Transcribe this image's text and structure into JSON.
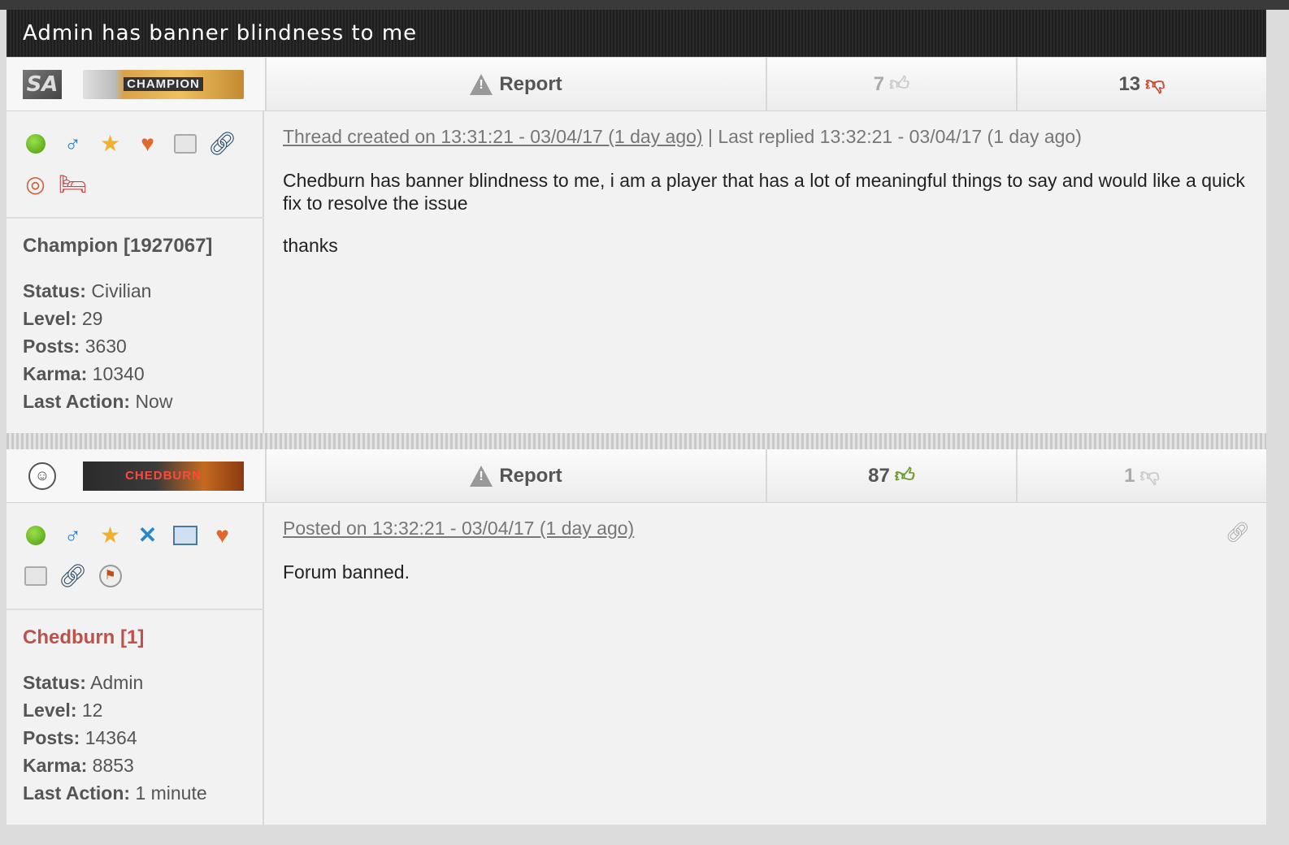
{
  "thread": {
    "title": "Admin has banner blindness to me"
  },
  "posts": [
    {
      "avatar_icon": "faction-logo-icon",
      "avatar_text": "SA",
      "banner_text": "CHAMPION",
      "report_label": "Report",
      "likes": "7",
      "dislikes": "13",
      "meta_link": "Thread created on 13:31:21 - 03/04/17 (1 day ago)",
      "meta_extra": "| Last replied 13:32:21 - 03/04/17 (1 day ago)",
      "body": [
        "Chedburn has banner blindness to me, i am a player that has a lot of meaningful things to say and would like a quick fix to resolve the issue",
        "thanks"
      ],
      "user": {
        "name": "Champion [1927067]",
        "status_label": "Status:",
        "status": "Civilian",
        "level_label": "Level:",
        "level": "29",
        "posts_label": "Posts:",
        "posts": "3630",
        "karma_label": "Karma:",
        "karma": "10340",
        "last_action_label": "Last Action:",
        "last_action": "Now"
      },
      "icons": [
        "online-icon",
        "male-icon",
        "star-icon",
        "heart-icon",
        "briefcase-icon",
        "link-icon",
        "target-icon",
        "hospital-bed-icon"
      ]
    },
    {
      "avatar_icon": "face-icon",
      "banner_text": "CHEDBURN",
      "report_label": "Report",
      "likes": "87",
      "dislikes": "1",
      "meta_link": "Posted on 13:32:21 - 03/04/17 (1 day ago)",
      "body": [
        "Forum banned."
      ],
      "user": {
        "name": "Chedburn [1]",
        "status_label": "Status:",
        "status": "Admin",
        "level_label": "Level:",
        "level": "12",
        "posts_label": "Posts:",
        "posts": "14364",
        "karma_label": "Karma:",
        "karma": "8853",
        "last_action_label": "Last Action:",
        "last_action": "1 minute"
      },
      "icons": [
        "online-icon",
        "male-icon",
        "star-icon",
        "crossed-tools-icon",
        "id-card-icon",
        "heart-icon",
        "briefcase-icon",
        "link-icon",
        "flag-badge-icon"
      ]
    }
  ],
  "colors": {
    "admin_name": "#c0504a",
    "like_green": "#6a9a2a",
    "dislike_red": "#c0503a"
  }
}
